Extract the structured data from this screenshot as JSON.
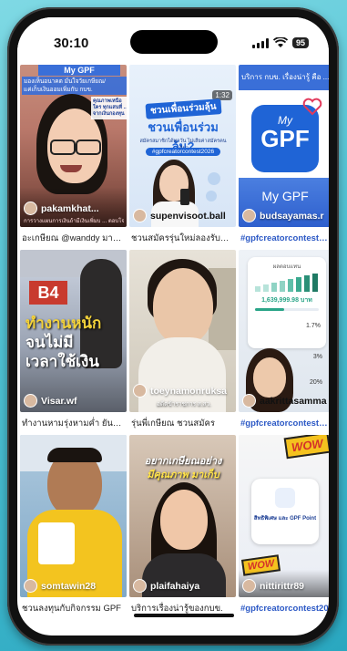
{
  "status": {
    "time": "30:10",
    "battery": "95"
  },
  "videos": [
    {
      "overlay_title": "My GPF",
      "overlay_lines": [
        "มองเห็นอนาคต มั่นใจวัยเกษียณ/",
        "แค่เก็บเงินออมเพิ่มกับ กบข."
      ],
      "side_text": "คุณภาพเหนือใคร ทุกแสนที่ ... จากเงินกองทุน",
      "bottom_text": "การวางแผนการเงินถ้ามีเงินเพิ่มบ ... ตอบโจทย์",
      "username": "pakamkhat...",
      "caption": "อะเกษียณ @wanddy มาว่า...",
      "caption_is_tag": false
    },
    {
      "overlay_title": "ชวนเพื่อนร่วมลุ้น?",
      "overlay_top": "ชวนเพื่อนร่วมลุ้น",
      "overlay_sub": "สมัครสมาชิกได้ทุกวัน ไม่เสียค่าสมัครคนเดียว",
      "hashtag": "#gpfcreatorcontest2026",
      "duration": "1:32",
      "username": "supenvisoot.ball",
      "caption": "ชวนสมัครรุ่นใหม่ลองรับตอนนี้",
      "caption_is_tag": false
    },
    {
      "overlay_title": "บริการ กบข. เรื่องน่ารู้ คือ ...",
      "logo_top": "My",
      "logo_main": "GPF",
      "logo_text": "My GPF",
      "username": "budsayamas.r",
      "caption": "#gpfcreatorcontest2026",
      "caption_is_tag": true
    },
    {
      "sign": "B4",
      "overlay_lines": [
        "ทำงานหนัก",
        "จนไม่มี",
        "เวลาใช้เงิน"
      ],
      "username": "Visar.wf",
      "caption": "ทำงานหามรุ่งหามค่ำ ยันฉมรุ...",
      "caption_is_tag": false
    },
    {
      "username": "toeynamonruksa",
      "sub_text": "อดีตข้าราชการ ส.สว.",
      "caption": "รุ่นพี่เกษียณ ชวนสมัคร",
      "caption_is_tag": false
    },
    {
      "chart_title": "ผลตอบแทน",
      "amount": "1,639,999.98 บาท",
      "pcts": [
        "1.7%",
        "3%",
        "20%"
      ],
      "username": "aakrittasamma",
      "caption": "#gpfcreatorcontest2026",
      "caption_is_tag": true
    },
    {
      "username": "somtawin28",
      "caption": "ชวนลงทุนกับกิจกรรม GPF",
      "caption_is_tag": false
    },
    {
      "overlay_lines": [
        "อยากเกษียณอย่าง",
        "มีคุณภาพ มาเก็บ"
      ],
      "username": "plaifahaiya",
      "caption": "บริการเรื่องน่ารู้ของกบข.",
      "caption_is_tag": false
    },
    {
      "badge_top": "WOW",
      "feature_text": "สิทธิพิเศษ และ GPF Point",
      "badge_bottom": "WOW",
      "username": "nittirittr89",
      "caption": "#gpfcreatorcontest20",
      "caption_is_tag": true
    }
  ],
  "colors": {
    "accent_blue": "#2b58c5",
    "gpf_blue": "#1f64d6"
  }
}
